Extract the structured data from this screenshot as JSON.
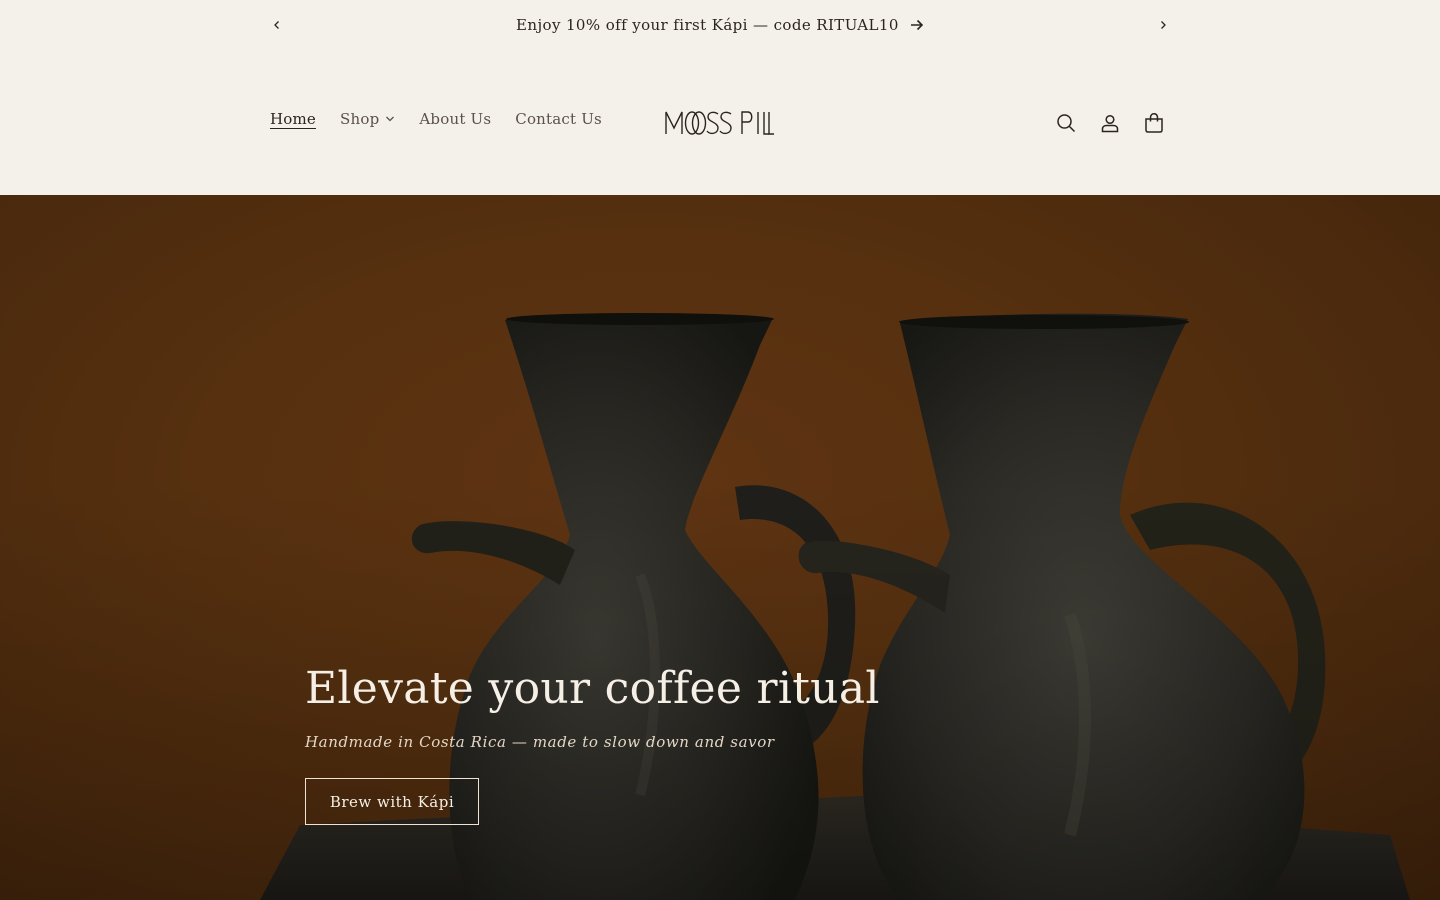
{
  "announcement": {
    "message": "Enjoy 10% off your first Kápi — code RITUAL10",
    "prev_icon": "chevron-left-icon",
    "next_icon": "chevron-right-icon",
    "arrow_icon": "arrow-right-icon"
  },
  "header": {
    "nav": [
      {
        "label": "Home",
        "active": true
      },
      {
        "label": "Shop",
        "has_dropdown": true
      },
      {
        "label": "About Us"
      },
      {
        "label": "Contact Us"
      }
    ],
    "logo_text": "MOSS PILL",
    "icons": [
      "search-icon",
      "account-icon",
      "cart-icon"
    ]
  },
  "hero": {
    "title": "Elevate your coffee ritual",
    "subtitle": "Handmade in Costa Rica — made to slow down and savor",
    "cta_label": "Brew with Kápi"
  },
  "colors": {
    "page_bg": "#f4f0ea",
    "hero_bg": "#56300f",
    "text_dark": "#2b2520",
    "hero_text": "#f6efe6"
  }
}
